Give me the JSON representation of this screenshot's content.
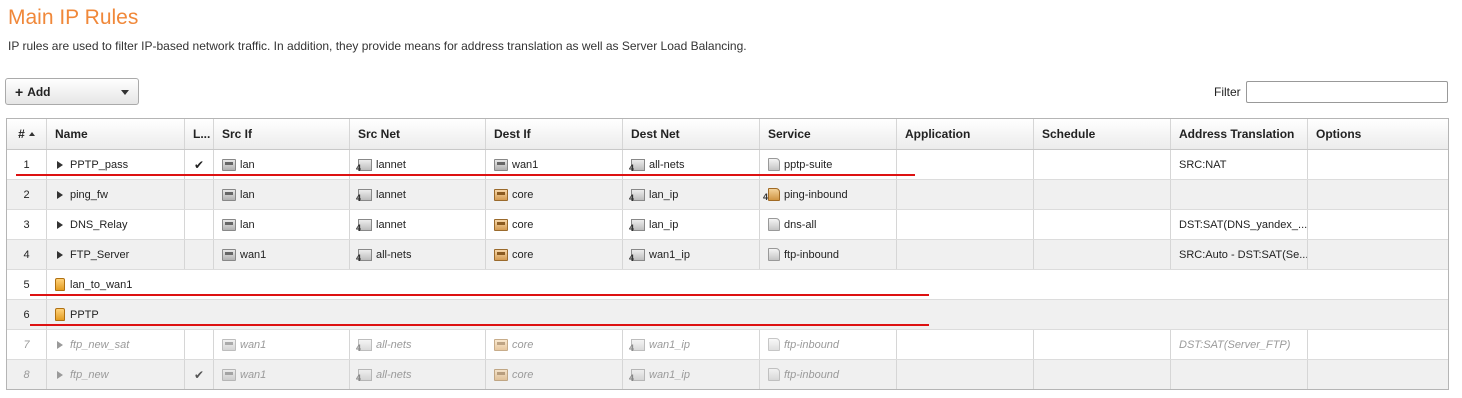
{
  "page": {
    "title": "Main IP Rules",
    "description": "IP rules are used to filter IP-based network traffic. In addition, they provide means for address translation as well as Server Load Balancing."
  },
  "toolbar": {
    "add_label": "Add",
    "filter_label": "Filter",
    "filter_value": ""
  },
  "columns": [
    "#",
    "Name",
    "L...",
    "Src If",
    "Src Net",
    "Dest If",
    "Dest Net",
    "Service",
    "Application",
    "Schedule",
    "Address Translation",
    "Options"
  ],
  "rows": [
    {
      "num": "1",
      "name": "PPTP_pass",
      "type": "rule",
      "log": "✔",
      "src_if": "lan",
      "src_net": "lannet",
      "dest_if": "wan1",
      "dest_net": "all-nets",
      "service": "pptp-suite",
      "application": "",
      "schedule": "",
      "translation": "SRC:NAT",
      "options": ""
    },
    {
      "num": "2",
      "name": "ping_fw",
      "type": "rule",
      "log": "",
      "src_if": "lan",
      "src_net": "lannet",
      "dest_if": "core",
      "dest_net": "lan_ip",
      "service": "ping-inbound",
      "application": "",
      "schedule": "",
      "translation": "",
      "options": ""
    },
    {
      "num": "3",
      "name": "DNS_Relay",
      "type": "rule",
      "log": "",
      "src_if": "lan",
      "src_net": "lannet",
      "dest_if": "core",
      "dest_net": "lan_ip",
      "service": "dns-all",
      "application": "",
      "schedule": "",
      "translation": "DST:SAT(DNS_yandex_...",
      "options": ""
    },
    {
      "num": "4",
      "name": "FTP_Server",
      "type": "rule",
      "log": "",
      "src_if": "wan1",
      "src_net": "all-nets",
      "dest_if": "core",
      "dest_net": "wan1_ip",
      "service": "ftp-inbound",
      "application": "",
      "schedule": "",
      "translation": "SRC:Auto - DST:SAT(Se...",
      "options": ""
    },
    {
      "num": "5",
      "name": "lan_to_wan1",
      "type": "folder"
    },
    {
      "num": "6",
      "name": "PPTP",
      "type": "folder"
    },
    {
      "num": "7",
      "name": "ftp_new_sat",
      "type": "rule",
      "disabled": true,
      "log": "",
      "src_if": "wan1",
      "src_net": "all-nets",
      "dest_if": "core",
      "dest_net": "wan1_ip",
      "service": "ftp-inbound",
      "application": "",
      "schedule": "",
      "translation": "DST:SAT(Server_FTP)",
      "options": ""
    },
    {
      "num": "8",
      "name": "ftp_new",
      "type": "rule",
      "disabled": true,
      "log": "✔",
      "src_if": "wan1",
      "src_net": "all-nets",
      "dest_if": "core",
      "dest_net": "wan1_ip",
      "service": "ftp-inbound",
      "application": "",
      "schedule": "",
      "translation": "",
      "options": ""
    }
  ],
  "annotation_color": "#dd1111"
}
